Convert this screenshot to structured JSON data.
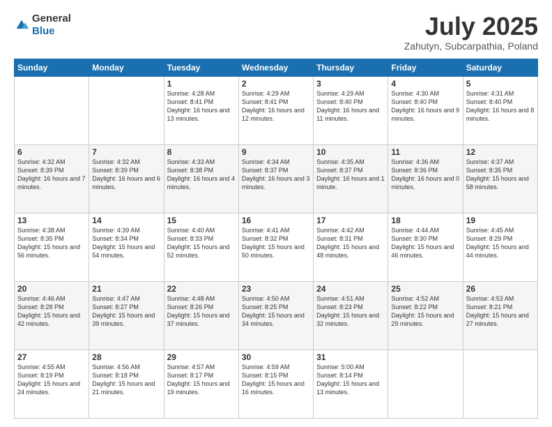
{
  "logo": {
    "general": "General",
    "blue": "Blue"
  },
  "header": {
    "month": "July 2025",
    "location": "Zahutyn, Subcarpathia, Poland"
  },
  "weekdays": [
    "Sunday",
    "Monday",
    "Tuesday",
    "Wednesday",
    "Thursday",
    "Friday",
    "Saturday"
  ],
  "weeks": [
    [
      {
        "day": "",
        "text": ""
      },
      {
        "day": "",
        "text": ""
      },
      {
        "day": "1",
        "text": "Sunrise: 4:28 AM\nSunset: 8:41 PM\nDaylight: 16 hours\nand 13 minutes."
      },
      {
        "day": "2",
        "text": "Sunrise: 4:29 AM\nSunset: 8:41 PM\nDaylight: 16 hours\nand 12 minutes."
      },
      {
        "day": "3",
        "text": "Sunrise: 4:29 AM\nSunset: 8:40 PM\nDaylight: 16 hours\nand 11 minutes."
      },
      {
        "day": "4",
        "text": "Sunrise: 4:30 AM\nSunset: 8:40 PM\nDaylight: 16 hours\nand 9 minutes."
      },
      {
        "day": "5",
        "text": "Sunrise: 4:31 AM\nSunset: 8:40 PM\nDaylight: 16 hours\nand 8 minutes."
      }
    ],
    [
      {
        "day": "6",
        "text": "Sunrise: 4:32 AM\nSunset: 8:39 PM\nDaylight: 16 hours\nand 7 minutes."
      },
      {
        "day": "7",
        "text": "Sunrise: 4:32 AM\nSunset: 8:39 PM\nDaylight: 16 hours\nand 6 minutes."
      },
      {
        "day": "8",
        "text": "Sunrise: 4:33 AM\nSunset: 8:38 PM\nDaylight: 16 hours\nand 4 minutes."
      },
      {
        "day": "9",
        "text": "Sunrise: 4:34 AM\nSunset: 8:37 PM\nDaylight: 16 hours\nand 3 minutes."
      },
      {
        "day": "10",
        "text": "Sunrise: 4:35 AM\nSunset: 8:37 PM\nDaylight: 16 hours\nand 1 minute."
      },
      {
        "day": "11",
        "text": "Sunrise: 4:36 AM\nSunset: 8:36 PM\nDaylight: 16 hours\nand 0 minutes."
      },
      {
        "day": "12",
        "text": "Sunrise: 4:37 AM\nSunset: 8:35 PM\nDaylight: 15 hours\nand 58 minutes."
      }
    ],
    [
      {
        "day": "13",
        "text": "Sunrise: 4:38 AM\nSunset: 8:35 PM\nDaylight: 15 hours\nand 56 minutes."
      },
      {
        "day": "14",
        "text": "Sunrise: 4:39 AM\nSunset: 8:34 PM\nDaylight: 15 hours\nand 54 minutes."
      },
      {
        "day": "15",
        "text": "Sunrise: 4:40 AM\nSunset: 8:33 PM\nDaylight: 15 hours\nand 52 minutes."
      },
      {
        "day": "16",
        "text": "Sunrise: 4:41 AM\nSunset: 8:32 PM\nDaylight: 15 hours\nand 50 minutes."
      },
      {
        "day": "17",
        "text": "Sunrise: 4:42 AM\nSunset: 8:31 PM\nDaylight: 15 hours\nand 48 minutes."
      },
      {
        "day": "18",
        "text": "Sunrise: 4:44 AM\nSunset: 8:30 PM\nDaylight: 15 hours\nand 46 minutes."
      },
      {
        "day": "19",
        "text": "Sunrise: 4:45 AM\nSunset: 8:29 PM\nDaylight: 15 hours\nand 44 minutes."
      }
    ],
    [
      {
        "day": "20",
        "text": "Sunrise: 4:46 AM\nSunset: 8:28 PM\nDaylight: 15 hours\nand 42 minutes."
      },
      {
        "day": "21",
        "text": "Sunrise: 4:47 AM\nSunset: 8:27 PM\nDaylight: 15 hours\nand 39 minutes."
      },
      {
        "day": "22",
        "text": "Sunrise: 4:48 AM\nSunset: 8:26 PM\nDaylight: 15 hours\nand 37 minutes."
      },
      {
        "day": "23",
        "text": "Sunrise: 4:50 AM\nSunset: 8:25 PM\nDaylight: 15 hours\nand 34 minutes."
      },
      {
        "day": "24",
        "text": "Sunrise: 4:51 AM\nSunset: 8:23 PM\nDaylight: 15 hours\nand 32 minutes."
      },
      {
        "day": "25",
        "text": "Sunrise: 4:52 AM\nSunset: 8:22 PM\nDaylight: 15 hours\nand 29 minutes."
      },
      {
        "day": "26",
        "text": "Sunrise: 4:53 AM\nSunset: 8:21 PM\nDaylight: 15 hours\nand 27 minutes."
      }
    ],
    [
      {
        "day": "27",
        "text": "Sunrise: 4:55 AM\nSunset: 8:19 PM\nDaylight: 15 hours\nand 24 minutes."
      },
      {
        "day": "28",
        "text": "Sunrise: 4:56 AM\nSunset: 8:18 PM\nDaylight: 15 hours\nand 21 minutes."
      },
      {
        "day": "29",
        "text": "Sunrise: 4:57 AM\nSunset: 8:17 PM\nDaylight: 15 hours\nand 19 minutes."
      },
      {
        "day": "30",
        "text": "Sunrise: 4:59 AM\nSunset: 8:15 PM\nDaylight: 15 hours\nand 16 minutes."
      },
      {
        "day": "31",
        "text": "Sunrise: 5:00 AM\nSunset: 8:14 PM\nDaylight: 15 hours\nand 13 minutes."
      },
      {
        "day": "",
        "text": ""
      },
      {
        "day": "",
        "text": ""
      }
    ]
  ]
}
